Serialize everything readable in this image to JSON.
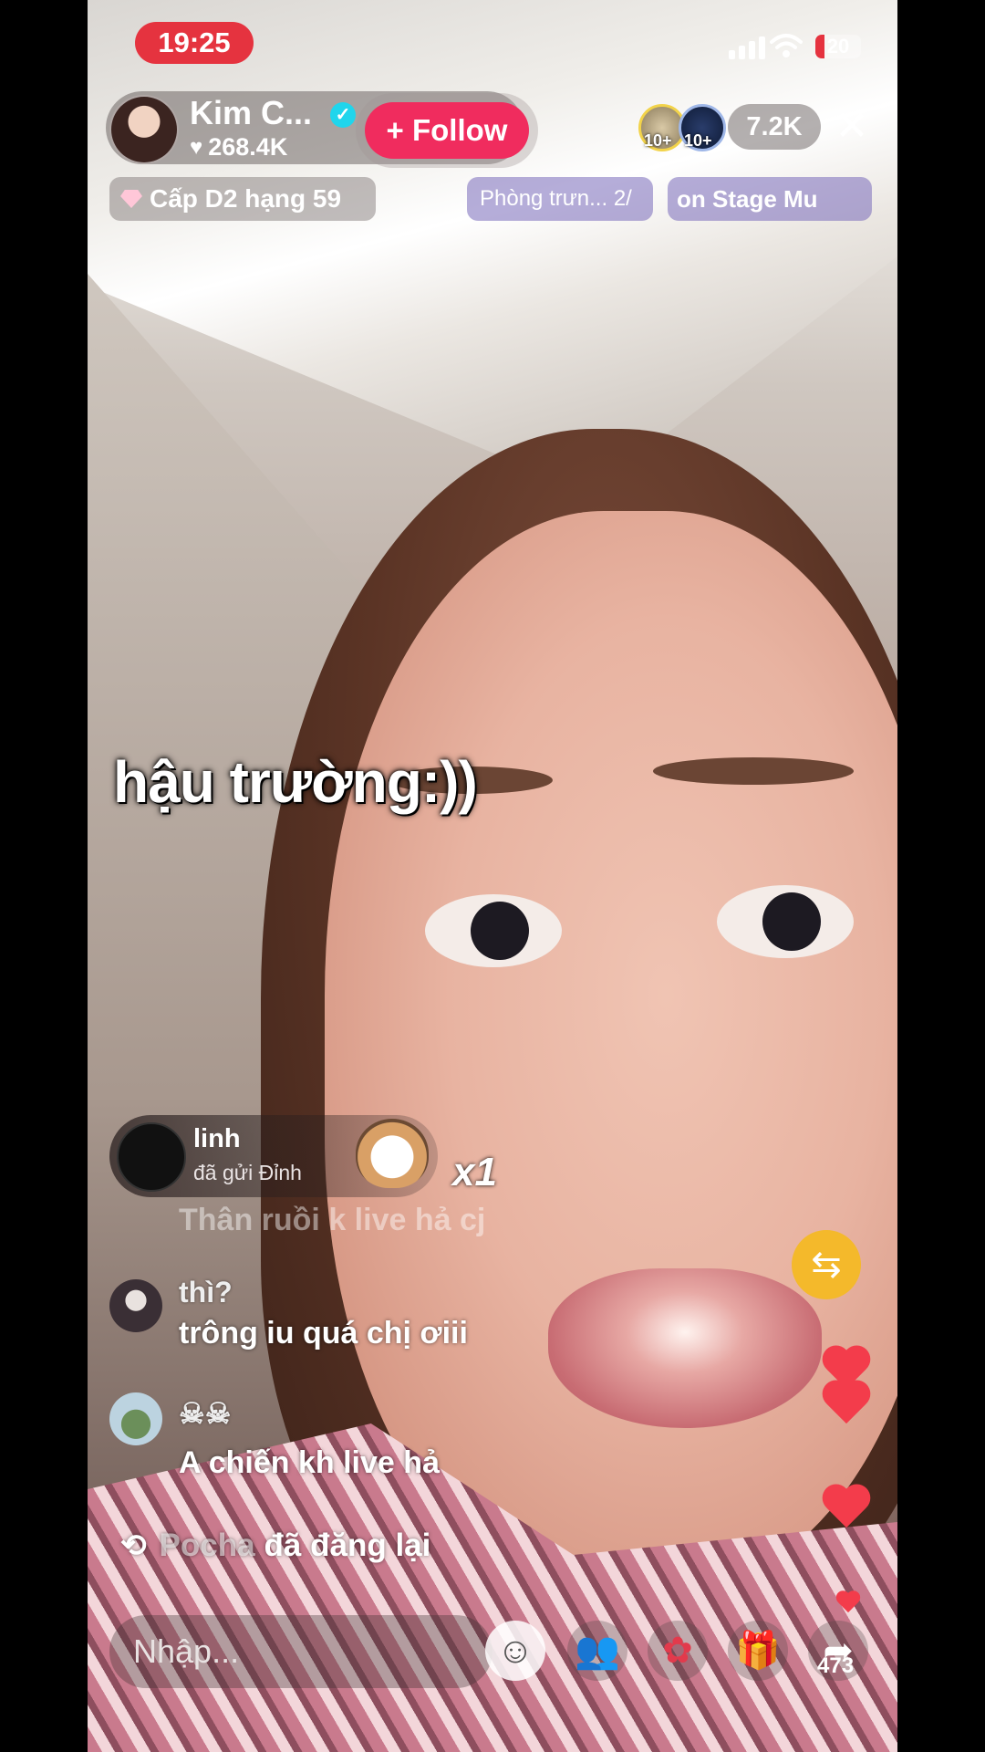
{
  "status_bar": {
    "time": "19:25",
    "battery": "20",
    "battery_level_percent": 20
  },
  "host": {
    "name": "Kim C...",
    "likes": "268.4K",
    "follow_label": "+ Follow"
  },
  "viewers": {
    "badge_1": "10+",
    "badge_2": "10+",
    "count": "7.2K"
  },
  "badges": {
    "rank": "Cấp D2 hạng 59",
    "room": "Phòng trưn... 2/",
    "stage": "on Stage  Mu"
  },
  "caption": "hậu trường:))",
  "gift": {
    "user": "linh",
    "text": "đã gửi Đỉnh",
    "count": "x1"
  },
  "comments": {
    "faded": "Thân ruồi k live hả cj",
    "c1_user": "thì?",
    "c1_text": "trông iu quá chị ơiii",
    "c2_user": "☠☠",
    "c2_text": "A chiến kh live hả",
    "repost_name": "Pocha",
    "repost_text": "đã đăng lại"
  },
  "bottom_bar": {
    "input_placeholder": "Nhập...",
    "share_count": "473"
  },
  "colors": {
    "live_red": "#e5333f",
    "follow_pink": "#f02c5e",
    "verified": "#20d5ec",
    "share_yellow": "#f4b92b",
    "heart": "#f33c4b"
  }
}
